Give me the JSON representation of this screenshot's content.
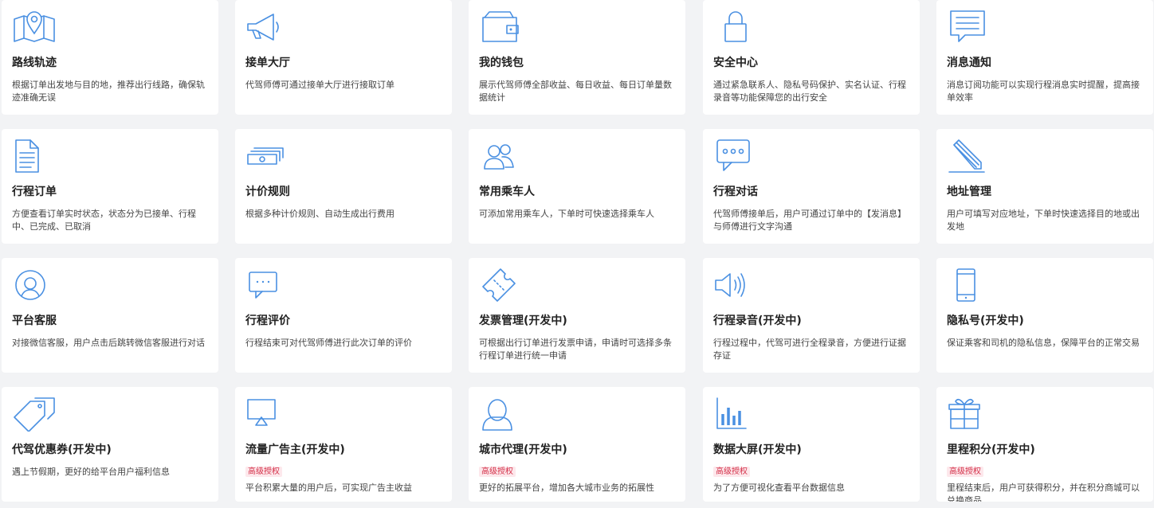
{
  "colors": {
    "icon": "#4a90e2",
    "badge_text": "#d4324a",
    "badge_bg": "#fde8ec"
  },
  "cards": [
    {
      "icon": "map-icon",
      "title": "路线轨迹",
      "desc": "根据订单出发地与目的地，推荐出行线路，确保轨迹准确无误"
    },
    {
      "icon": "megaphone-icon",
      "title": "接单大厅",
      "desc": "代驾师傅可通过接单大厅进行接取订单"
    },
    {
      "icon": "wallet-icon",
      "title": "我的钱包",
      "desc": "展示代驾师傅全部收益、每日收益、每日订单量数据统计"
    },
    {
      "icon": "lock-icon",
      "title": "安全中心",
      "desc": "通过紧急联系人、隐私号码保护、实名认证、行程录音等功能保障您的出行安全"
    },
    {
      "icon": "message-icon",
      "title": "消息通知",
      "desc": "消息订阅功能可以实现行程消息实时提醒，提高接单效率"
    },
    {
      "icon": "document-icon",
      "title": "行程订单",
      "desc": "方便查看订单实时状态，状态分为已接单、行程中、已完成、已取消"
    },
    {
      "icon": "money-icon",
      "title": "计价规则",
      "desc": "根据多种计价规则、自动生成出行费用"
    },
    {
      "icon": "users-icon",
      "title": "常用乘车人",
      "desc": "可添加常用乘车人，下单时可快速选择乘车人"
    },
    {
      "icon": "chat-icon",
      "title": "行程对话",
      "desc": "代驾师傅接单后，用户可通过订单中的【发消息】与师傅进行文字沟通"
    },
    {
      "icon": "pencil-icon",
      "title": "地址管理",
      "desc": "用户可填写对应地址，下单时快速选择目的地或出发地"
    },
    {
      "icon": "user-circle-icon",
      "title": "平台客服",
      "desc": "对接微信客服，用户点击后跳转微信客服进行对话"
    },
    {
      "icon": "comment-icon",
      "title": "行程评价",
      "desc": "行程结束可对代驾师傅进行此次订单的评价"
    },
    {
      "icon": "ticket-icon",
      "title": "发票管理(开发中)",
      "desc": "可根据出行订单进行发票申请，申请时可选择多条行程订单进行统一申请"
    },
    {
      "icon": "speaker-icon",
      "title": "行程录音(开发中)",
      "desc": "行程过程中，代驾可进行全程录音，方便进行证据存证"
    },
    {
      "icon": "phone-icon",
      "title": "隐私号(开发中)",
      "desc": "保证乘客和司机的隐私信息，保障平台的正常交易"
    },
    {
      "icon": "tags-icon",
      "title": "代驾优惠券(开发中)",
      "desc": "遇上节假期，更好的给平台用户福利信息"
    },
    {
      "icon": "screen-icon",
      "title": "流量广告主(开发中)",
      "badge": "高级授权",
      "desc": "平台积累大量的用户后，可实现广告主收益"
    },
    {
      "icon": "person-icon",
      "title": "城市代理(开发中)",
      "badge": "高级授权",
      "desc": "更好的拓展平台，增加各大城市业务的拓展性"
    },
    {
      "icon": "bar-chart-icon",
      "title": "数据大屏(开发中)",
      "badge": "高级授权",
      "desc": "为了方便可视化查看平台数据信息"
    },
    {
      "icon": "gift-icon",
      "title": "里程积分(开发中)",
      "badge": "高级授权",
      "desc": "里程结束后，用户可获得积分，并在积分商城可以兑换商品"
    }
  ]
}
